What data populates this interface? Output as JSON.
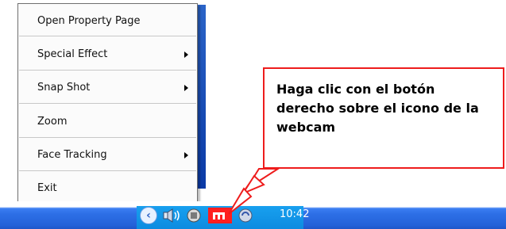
{
  "context_menu": {
    "items": [
      {
        "label": "Open Property Page",
        "submenu": false
      },
      {
        "label": "Special Effect",
        "submenu": true
      },
      {
        "label": "Snap Shot",
        "submenu": true
      },
      {
        "label": "Zoom",
        "submenu": false
      },
      {
        "label": "Face Tracking",
        "submenu": true
      },
      {
        "label": "Exit",
        "submenu": false
      }
    ]
  },
  "callout": {
    "text": "Haga clic con el botón derecho sobre el icono de la webcam",
    "border_color": "#ee1c1c"
  },
  "taskbar": {
    "clock": "10:42",
    "tray_icons": [
      "show-hidden-icons-chevron",
      "speaker-icon",
      "network-icon",
      "webcam-icon",
      "update-icon"
    ]
  },
  "colors": {
    "taskbar_blue": "#2462d9",
    "tray_blue": "#0d8be0",
    "callout_red": "#ee1c1c"
  }
}
